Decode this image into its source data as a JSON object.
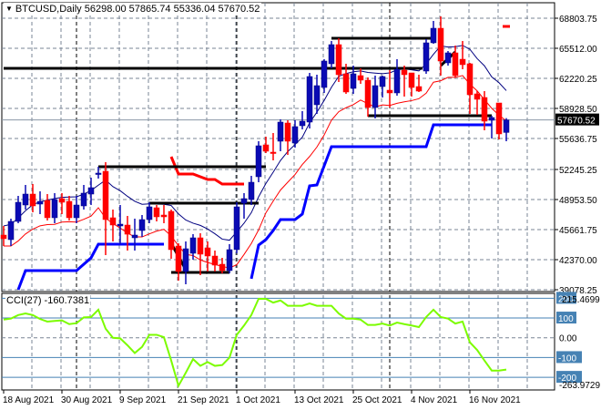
{
  "header": {
    "symbol": "BTCUSD,Daily",
    "ohlc": "56298.00 57865.74 55336.04 57670.52"
  },
  "cci_header": "CCI(27) -160.7381",
  "colors": {
    "bull": "#0A0AB4",
    "bear": "#FF0000",
    "upper_line": "#000080",
    "lower_line": "#FF0000",
    "support_step": "#0000FF",
    "resistance_step": "#FF0000",
    "levels": "#000000",
    "cci": "#7CFC00",
    "cci_levels": "#4682B4",
    "grid": "#7A8696"
  },
  "chart_data": [
    {
      "type": "candlestick",
      "title": "BTCUSD,Daily",
      "ylim": [
        38880,
        70500
      ],
      "y_ticks": [
        "68803.75",
        "65512.00",
        "62220.25",
        "58928.50",
        "55636.75",
        "52245.25",
        "48953.50",
        "45661.75",
        "42370.00",
        "39078.25"
      ],
      "current_price": "57670.52",
      "x_labels": [
        {
          "index": 0,
          "label": "18 Aug 2021"
        },
        {
          "index": 8,
          "label": "30 Aug 2021"
        },
        {
          "index": 16,
          "label": "9 Sep 2021"
        },
        {
          "index": 24,
          "label": "21 Sep 2021"
        },
        {
          "index": 32,
          "label": "1 Oct 2021"
        },
        {
          "index": 40,
          "label": "13 Oct 2021"
        },
        {
          "index": 48,
          "label": "25 Oct 2021"
        },
        {
          "index": 56,
          "label": "4 Nov 2021"
        },
        {
          "index": 64,
          "label": "16 Nov 2021"
        }
      ],
      "month_separators": [
        10,
        32,
        53
      ],
      "candles_ohlc": [
        [
          45064,
          46062,
          43868,
          44666
        ],
        [
          44566,
          46860,
          43868,
          46561
        ],
        [
          46561,
          49354,
          46361,
          48656
        ],
        [
          48356,
          50550,
          47857,
          49553
        ],
        [
          49553,
          50650,
          47558,
          48256
        ],
        [
          48456,
          49852,
          47359,
          48755
        ],
        [
          48855,
          49553,
          46660,
          46960
        ],
        [
          46960,
          49653,
          46361,
          48955
        ],
        [
          49054,
          49653,
          47359,
          48656
        ],
        [
          48755,
          49354,
          46660,
          46960
        ],
        [
          46960,
          49354,
          46361,
          48356
        ],
        [
          48256,
          50550,
          47857,
          49653
        ],
        [
          49553,
          51349,
          48356,
          50252
        ],
        [
          51742,
          52546,
          51249,
          51847
        ],
        [
          52047,
          53044,
          42870,
          46760
        ],
        [
          46960,
          47857,
          44366,
          46162
        ],
        [
          46062,
          48356,
          44067,
          46261
        ],
        [
          46162,
          47159,
          43369,
          45159
        ],
        [
          44765,
          46860,
          43369,
          45064
        ],
        [
          45563,
          47259,
          44865,
          46760
        ],
        [
          46760,
          48656,
          46361,
          48157
        ],
        [
          48057,
          48356,
          46561,
          47059
        ],
        [
          47259,
          48356,
          46361,
          47059
        ],
        [
          47658,
          47857,
          42471,
          43469
        ],
        [
          43868,
          44167,
          40073,
          41075
        ],
        [
          41075,
          44366,
          39678,
          43568
        ],
        [
          43070,
          45164,
          42371,
          44765
        ],
        [
          44765,
          45264,
          40676,
          42970
        ],
        [
          43668,
          44366,
          41075,
          42770
        ],
        [
          42770,
          43369,
          41075,
          41773
        ],
        [
          41873,
          42571,
          40875,
          41174
        ],
        [
          41174,
          44067,
          40875,
          43469
        ],
        [
          43469,
          48656,
          43070,
          48157
        ],
        [
          48556,
          49653,
          46860,
          49054
        ],
        [
          48955,
          51548,
          48356,
          50850
        ],
        [
          51449,
          55339,
          50850,
          54840
        ],
        [
          54940,
          55838,
          54042,
          54242
        ],
        [
          54142,
          56237,
          53244,
          54042
        ],
        [
          55339,
          57733,
          54242,
          57434
        ],
        [
          57334,
          57633,
          53843,
          55339
        ],
        [
          55139,
          57633,
          54641,
          56935
        ],
        [
          57035,
          58631,
          56636,
          57533
        ],
        [
          57434,
          62820,
          56735,
          62421
        ],
        [
          59329,
          62621,
          58331,
          61424
        ],
        [
          61224,
          64316,
          60626,
          64117
        ],
        [
          63818,
          66311,
          63319,
          65913
        ],
        [
          65913,
          66611,
          61823,
          62621
        ],
        [
          62720,
          63818,
          60526,
          60725
        ],
        [
          61124,
          63618,
          60526,
          62720
        ],
        [
          62521,
          63319,
          61623,
          62022
        ],
        [
          62022,
          62321,
          58032,
          59030
        ],
        [
          59030,
          62521,
          57833,
          61424
        ],
        [
          61324,
          62521,
          60127,
          62421
        ],
        [
          60925,
          63119,
          59030,
          60626
        ],
        [
          60626,
          64316,
          60327,
          63219
        ],
        [
          63119,
          63618,
          60227,
          62621
        ],
        [
          62820,
          62820,
          60227,
          61224
        ],
        [
          61324,
          62621,
          60726,
          60825
        ],
        [
          63019,
          66511,
          62720,
          66112
        ],
        [
          66112,
          68506,
          66012,
          67708
        ],
        [
          67708,
          69005,
          62521,
          64117
        ],
        [
          63918,
          65214,
          63618,
          65015
        ],
        [
          65015,
          65813,
          62321,
          62521
        ],
        [
          64316,
          66311,
          63219,
          63718
        ],
        [
          63818,
          63918,
          58331,
          60426
        ],
        [
          60526,
          60825,
          58232,
          59927
        ],
        [
          60127,
          60825,
          56536,
          57533
        ],
        [
          57633,
          58132,
          55638,
          57932
        ],
        [
          59528,
          59528,
          55538,
          56137
        ],
        [
          56298.0,
          57865.74,
          55336.04,
          57670.52
        ]
      ],
      "support_step": [
        [
          2,
          39079
        ],
        [
          3,
          41174
        ],
        [
          10,
          41174
        ],
        [
          12,
          42571
        ],
        [
          13,
          44067
        ],
        [
          22,
          44067
        ]
      ],
      "support_step_2": [
        [
          34,
          40277
        ],
        [
          35,
          43967
        ],
        [
          36,
          44566
        ],
        [
          37,
          45563
        ],
        [
          38,
          46760
        ],
        [
          40,
          46760
        ],
        [
          41,
          47359
        ],
        [
          42,
          50451
        ],
        [
          43,
          50550
        ],
        [
          44,
          52646
        ],
        [
          45,
          54740
        ],
        [
          58,
          54740
        ],
        [
          59,
          57134
        ],
        [
          67,
          57134
        ]
      ],
      "resistance_step": [
        [
          23,
          53643
        ],
        [
          24,
          51747
        ],
        [
          26,
          51747
        ],
        [
          28,
          51149
        ],
        [
          29,
          51149
        ],
        [
          30,
          50650
        ],
        [
          33,
          50650
        ]
      ],
      "resistance_step_2": [
        [
          68.5,
          67907
        ],
        [
          69.5,
          67907
        ]
      ],
      "levels": [
        {
          "from": 0,
          "to": 57.5,
          "price": 63319
        },
        {
          "from": 45,
          "to": 59,
          "price": 66611
        },
        {
          "from": 13,
          "to": 36,
          "price": 52546
        },
        {
          "from": 20,
          "to": 35,
          "price": 48556
        },
        {
          "from": 23,
          "to": 31,
          "price": 40975
        },
        {
          "from": 50,
          "to": 67,
          "price": 58131
        }
      ],
      "zigzag_segments": [
        [
          23,
          44166,
          24.8,
          41573
        ],
        [
          60,
          63618,
          62,
          65114
        ]
      ]
    },
    {
      "type": "line",
      "title": "CCI(27) -160.7381",
      "ylim": [
        -263.9729,
        215.4699
      ],
      "levels": [
        200,
        100,
        -100,
        -200
      ],
      "zero": 0,
      "y_tick_labels": {
        "top": "215.4699",
        "l200": "200",
        "l100": "100",
        "zero": "0.00",
        "lm100": "-100",
        "lm200": "-200",
        "bottom": "-263.9729"
      },
      "values": [
        92,
        97,
        115,
        123,
        115,
        95,
        82,
        85,
        88,
        69,
        74,
        103,
        105,
        142,
        46,
        0,
        -3,
        -38,
        -77,
        -46,
        15,
        15,
        3,
        -115,
        -243,
        -177,
        -108,
        -142,
        -123,
        -142,
        -138,
        -100,
        15,
        62,
        115,
        197,
        197,
        178,
        189,
        162,
        162,
        162,
        174,
        162,
        162,
        162,
        123,
        97,
        97,
        92,
        65,
        65,
        72,
        62,
        77,
        69,
        62,
        54,
        105,
        142,
        105,
        97,
        72,
        82,
        -23,
        -62,
        -115,
        -166,
        -166,
        -160.7381
      ]
    }
  ]
}
